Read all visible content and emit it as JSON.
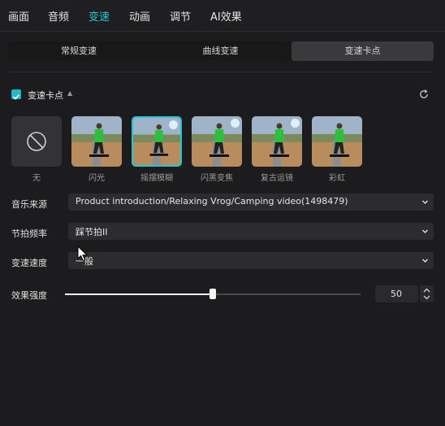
{
  "top_tabs": [
    "画面",
    "音频",
    "变速",
    "动画",
    "调节",
    "AI效果"
  ],
  "speed_tabs": [
    "常规变速",
    "曲线变速",
    "变速卡点"
  ],
  "section": {
    "title": "变速卡点",
    "checked": true
  },
  "effects": [
    {
      "label": "无",
      "kind": "none"
    },
    {
      "label": "闪光",
      "kind": "preview"
    },
    {
      "label": "摇摆模糊",
      "kind": "preview",
      "selected": true
    },
    {
      "label": "闪黑变焦",
      "kind": "preview"
    },
    {
      "label": "复古运镜",
      "kind": "preview"
    },
    {
      "label": "彩虹",
      "kind": "preview"
    }
  ],
  "music_source": {
    "label": "音乐来源",
    "value": "Product introduction/Relaxing Vrog/Camping video(1498479)"
  },
  "beat_frequency": {
    "label": "节拍频率",
    "value": "踩节拍II"
  },
  "speed_rate": {
    "label": "变速速度",
    "value": "一般"
  },
  "effect_strength": {
    "label": "效果强度",
    "value": "50",
    "level": 0.5
  },
  "colors": {
    "accent": "#28c8d4",
    "panel": "#1c1c1e"
  }
}
